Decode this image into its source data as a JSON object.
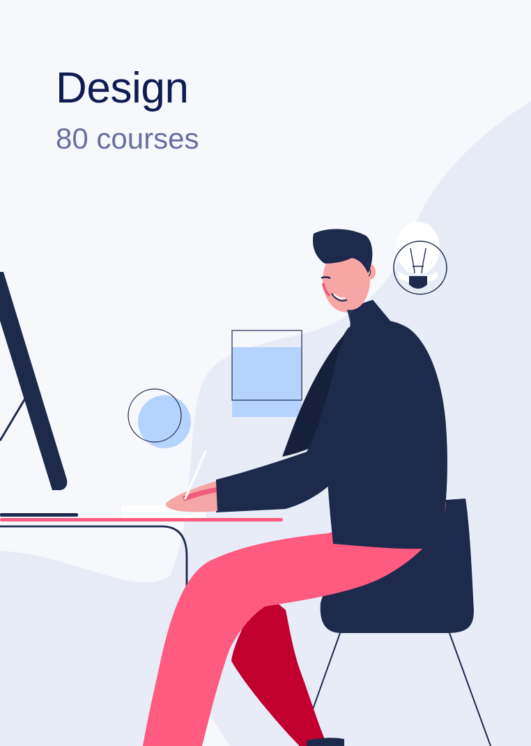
{
  "card": {
    "title": "Design",
    "subtitle": "80 courses"
  },
  "illustration": {
    "subject": "designer-at-desk",
    "icons": [
      "lightbulb-icon",
      "circle-shape",
      "square-shape"
    ],
    "colors": {
      "background": "#f6f8fc",
      "blob": "#e7ecf7",
      "navy": "#1d2a4c",
      "pink": "#ff5a80",
      "crimson": "#c2002f",
      "skin": "#f7a6a6",
      "light_blue": "#b5d3ff",
      "white": "#ffffff"
    }
  }
}
